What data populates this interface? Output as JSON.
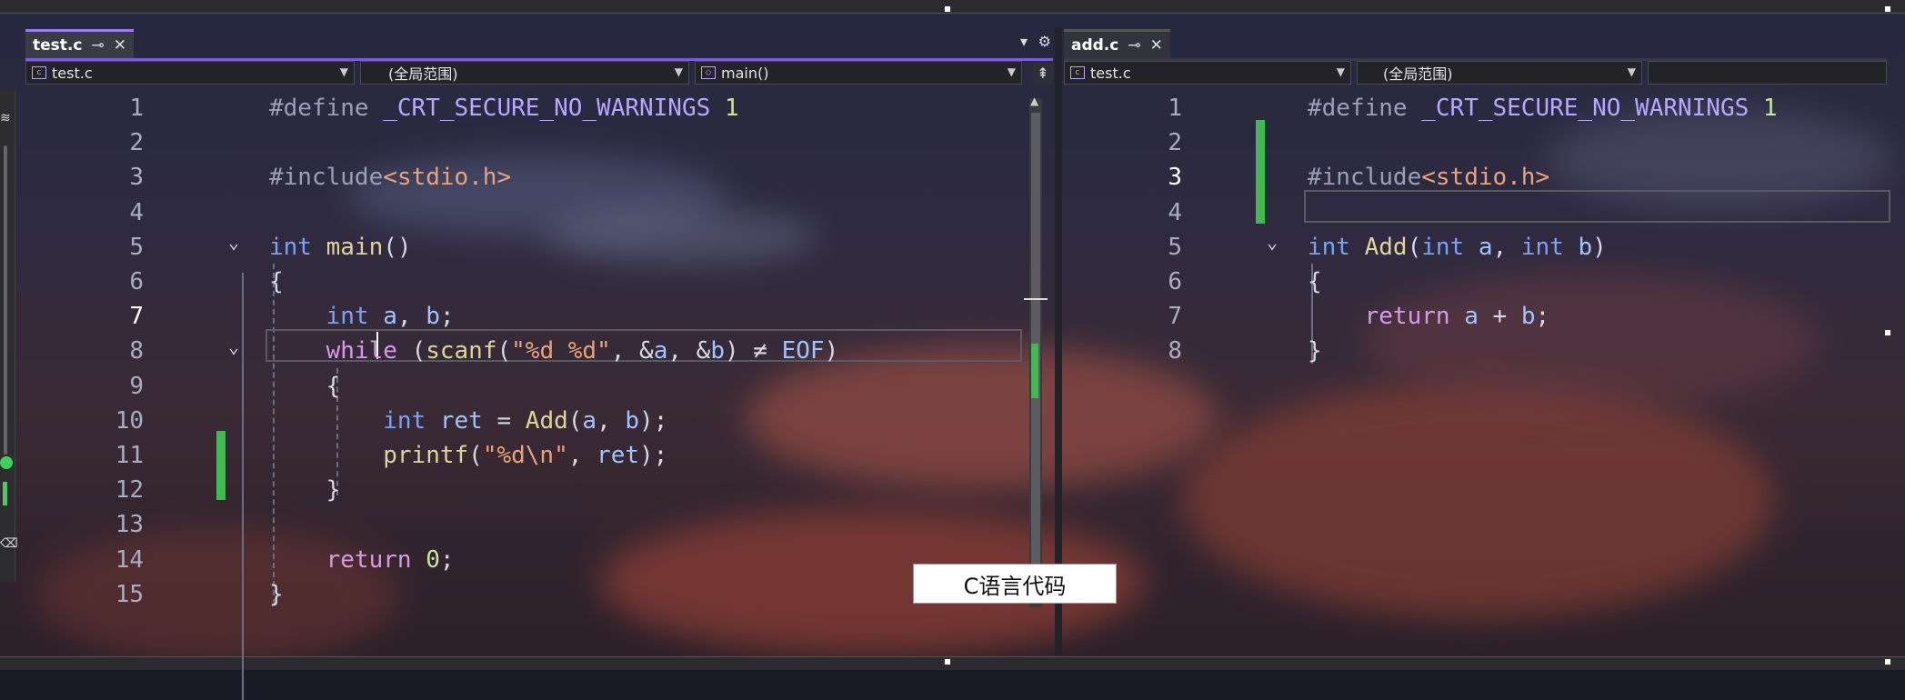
{
  "left_editor": {
    "tab": {
      "name": "test.c",
      "pin": "⊸",
      "close": "✕"
    },
    "tab_controls": {
      "dropdown": "▾",
      "settings": "⚙"
    },
    "nav": {
      "file": "test.c",
      "scope": "(全局范围)",
      "member": "main()",
      "split": "⇞"
    },
    "lines": [
      {
        "num": "1",
        "html": "<span class=\"pp\">#define</span> <span class=\"macro\">_CRT_SECURE_NO_WARNINGS</span> <span class=\"num\">1</span>"
      },
      {
        "num": "2",
        "html": ""
      },
      {
        "num": "3",
        "html": "<span class=\"pp\">#include</span><span class=\"str\">&lt;stdio.h&gt;</span>"
      },
      {
        "num": "4",
        "html": ""
      },
      {
        "num": "5",
        "html": "<span class=\"kw\">int</span> <span class=\"fn\">main</span><span class=\"op\">()</span>"
      },
      {
        "num": "6",
        "html": "<span class=\"op\">{</span>"
      },
      {
        "num": "7",
        "html": "    <span class=\"kw\">int</span> <span class=\"var\">a</span><span class=\"op\">,</span> <span class=\"var\">b</span><span class=\"op\">;</span>"
      },
      {
        "num": "8",
        "html": "    <span class=\"kw2\">while</span> <span class=\"op\">(</span><span class=\"fn\">scanf</span><span class=\"op\">(</span><span class=\"str\">\"%d %d\"</span><span class=\"op\">,</span> <span class=\"op\">&amp;</span><span class=\"var\">a</span><span class=\"op\">,</span> <span class=\"op\">&amp;</span><span class=\"var\">b</span><span class=\"op\">) ≠</span> <span class=\"var\">EOF</span><span class=\"op\">)</span>"
      },
      {
        "num": "9",
        "html": "    <span class=\"op\">{</span>"
      },
      {
        "num": "10",
        "html": "        <span class=\"kw\">int</span> <span class=\"var\">ret</span> <span class=\"op\">=</span> <span class=\"fn\">Add</span><span class=\"op\">(</span><span class=\"var\">a</span><span class=\"op\">,</span> <span class=\"var\">b</span><span class=\"op\">);</span>"
      },
      {
        "num": "11",
        "html": "        <span class=\"fn\">printf</span><span class=\"op\">(</span><span class=\"str\">\"%d\\n\"</span><span class=\"op\">,</span> <span class=\"var\">ret</span><span class=\"op\">);</span>"
      },
      {
        "num": "12",
        "html": "    <span class=\"op\">}</span>"
      },
      {
        "num": "13",
        "html": ""
      },
      {
        "num": "14",
        "html": "    <span class=\"kw2\">return</span> <span class=\"num\">0</span><span class=\"op\">;</span>"
      },
      {
        "num": "15",
        "html": "<span class=\"op\">}</span>"
      }
    ]
  },
  "right_editor": {
    "tab": {
      "name": "add.c",
      "pin": "⊸",
      "close": "✕"
    },
    "nav": {
      "file": "test.c",
      "scope": "(全局范围)"
    },
    "lines": [
      {
        "num": "1",
        "html": "<span class=\"pp\">#define</span> <span class=\"macro\">_CRT_SECURE_NO_WARNINGS</span> <span class=\"num\">1</span>"
      },
      {
        "num": "2",
        "html": ""
      },
      {
        "num": "3",
        "html": "<span class=\"pp\">#include</span><span class=\"str\">&lt;stdio.h&gt;</span>"
      },
      {
        "num": "4",
        "html": ""
      },
      {
        "num": "5",
        "html": "<span class=\"kw\">int</span> <span class=\"fn\">Add</span><span class=\"op\">(</span><span class=\"kw\">int</span> <span class=\"var\">a</span><span class=\"op\">,</span> <span class=\"kw\">int</span> <span class=\"var\">b</span><span class=\"op\">)</span>"
      },
      {
        "num": "6",
        "html": "<span class=\"op\">{</span>"
      },
      {
        "num": "7",
        "html": "    <span class=\"kw2\">return</span> <span class=\"var\">a</span> <span class=\"op\">+</span> <span class=\"var\">b</span><span class=\"op\">;</span>"
      },
      {
        "num": "8",
        "html": "<span class=\"op\">}</span>"
      }
    ]
  },
  "toolbar_strip": {
    "top_icon": "≋",
    "bottom_icon": "⌫"
  },
  "caption": "C语言代码",
  "icons": {
    "fold": "chevron-down-icon",
    "file": "c-file-icon",
    "member": "cube-icon"
  },
  "colors": {
    "accent": "#7a5fd6",
    "change": "#3fb950",
    "keyword": "#7aa2f7",
    "function": "#e0d49a",
    "string": "#e8a37a"
  }
}
